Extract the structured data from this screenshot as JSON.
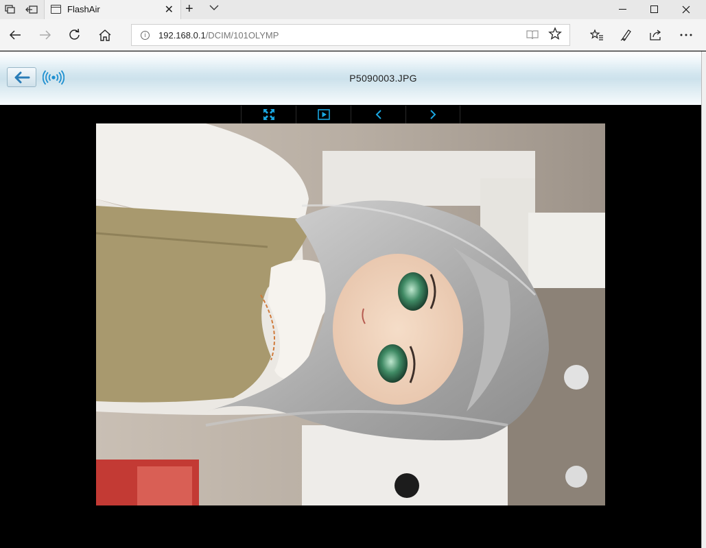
{
  "browser": {
    "tab_title": "FlashAir",
    "url_host": "192.168.0.1",
    "url_path": "/DCIM/101OLYMP"
  },
  "icons": {
    "tab_actions": "tab-actions-icon",
    "set_aside": "set-aside-icon",
    "new_tab": "plus-icon",
    "tab_list": "chevron-down-icon",
    "back": "back-arrow-icon",
    "forward": "forward-arrow-icon",
    "refresh": "refresh-icon",
    "home": "home-icon",
    "site_info": "info-icon",
    "reading_view": "book-icon",
    "favorite": "star-icon",
    "favorites_hub": "favorites-list-icon",
    "notes": "pen-icon",
    "share": "share-icon",
    "more": "ellipsis-icon",
    "fullscreen": "fullscreen-icon",
    "slideshow": "play-icon",
    "prev": "chevron-left-icon",
    "next": "chevron-right-icon",
    "wifi_logo": "flashair-wifi-icon"
  },
  "viewer": {
    "filename": "P5090003.JPG"
  },
  "colors": {
    "accent": "#1aa6e0",
    "header_mid": "#cde2ec",
    "background": "#000000"
  }
}
